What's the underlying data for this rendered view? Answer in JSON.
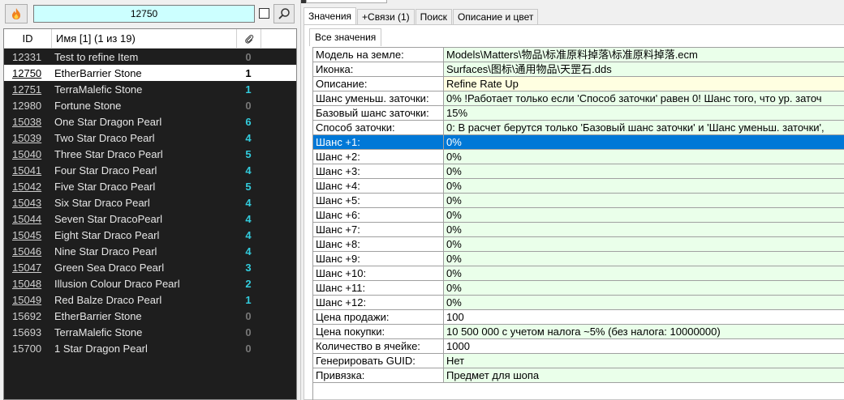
{
  "search": {
    "value": "12750"
  },
  "list": {
    "header": {
      "id": "ID",
      "name": "Имя [1] (1 из 19)"
    },
    "rows": [
      {
        "id": "12331",
        "name": "Test to refine Item",
        "count": "0",
        "color": "#777777",
        "underline": false,
        "selected": false
      },
      {
        "id": "12750",
        "name": "EtherBarrier Stone",
        "count": "1",
        "color": "#000000",
        "underline": true,
        "selected": true
      },
      {
        "id": "12751",
        "name": "TerraMalefic Stone",
        "count": "1",
        "color": "#33ccdd",
        "underline": true,
        "selected": false
      },
      {
        "id": "12980",
        "name": "Fortune Stone",
        "count": "0",
        "color": "#777777",
        "underline": false,
        "selected": false
      },
      {
        "id": "15038",
        "name": "One Star Dragon Pearl",
        "count": "6",
        "color": "#33ccdd",
        "underline": true,
        "selected": false
      },
      {
        "id": "15039",
        "name": "Two Star Draco Pearl",
        "count": "4",
        "color": "#33ccdd",
        "underline": true,
        "selected": false
      },
      {
        "id": "15040",
        "name": "Three Star Draco Pearl",
        "count": "5",
        "color": "#33ccdd",
        "underline": true,
        "selected": false
      },
      {
        "id": "15041",
        "name": "Four Star Draco Pearl",
        "count": "4",
        "color": "#33ccdd",
        "underline": true,
        "selected": false
      },
      {
        "id": "15042",
        "name": "Five Star Draco Pearl",
        "count": "5",
        "color": "#33ccdd",
        "underline": true,
        "selected": false
      },
      {
        "id": "15043",
        "name": "Six Star Draco Pearl",
        "count": "4",
        "color": "#33ccdd",
        "underline": true,
        "selected": false
      },
      {
        "id": "15044",
        "name": "Seven Star DracoPearl",
        "count": "4",
        "color": "#33ccdd",
        "underline": true,
        "selected": false
      },
      {
        "id": "15045",
        "name": "Eight Star Draco Pearl",
        "count": "4",
        "color": "#33ccdd",
        "underline": true,
        "selected": false
      },
      {
        "id": "15046",
        "name": "Nine Star Draco Pearl",
        "count": "4",
        "color": "#33ccdd",
        "underline": true,
        "selected": false
      },
      {
        "id": "15047",
        "name": "Green Sea Draco Pearl",
        "count": "3",
        "color": "#33ccdd",
        "underline": true,
        "selected": false
      },
      {
        "id": "15048",
        "name": "Illusion Colour Draco Pearl",
        "count": "2",
        "color": "#33ccdd",
        "underline": true,
        "selected": false
      },
      {
        "id": "15049",
        "name": "Red Balze Draco Pearl",
        "count": "1",
        "color": "#33ccdd",
        "underline": true,
        "selected": false
      },
      {
        "id": "15692",
        "name": "EtherBarrier Stone",
        "count": "0",
        "color": "#777777",
        "underline": false,
        "selected": false
      },
      {
        "id": "15693",
        "name": "TerraMalefic Stone",
        "count": "0",
        "color": "#777777",
        "underline": false,
        "selected": false
      },
      {
        "id": "15700",
        "name": "1 Star Dragon Pearl",
        "count": "0",
        "color": "#777777",
        "underline": false,
        "selected": false
      }
    ]
  },
  "tabs": [
    "Значения",
    "+Связи (1)",
    "Поиск",
    "Описание и цвет"
  ],
  "subtab": "Все значения",
  "properties": [
    {
      "key": "Модель на земле:",
      "value": "Models\\Matters\\物品\\标准原料掉落\\标准原料掉落.ecm",
      "bg": "green"
    },
    {
      "key": "Иконка:",
      "value": "Surfaces\\图标\\通用物品\\天罡石.dds",
      "bg": "green"
    },
    {
      "key": "Описание:",
      "value": "Refine Rate Up",
      "bg": "yellow"
    },
    {
      "key": "Шанс уменьш. заточки:",
      "value": "0% !Работает только если 'Способ заточки' равен 0! Шанс того, что ур. заточ",
      "bg": "green"
    },
    {
      "key": "Базовый шанс заточки:",
      "value": "15%",
      "bg": "green"
    },
    {
      "key": "Способ заточки:",
      "value": "0: В расчет берутся только 'Базовый шанс заточки' и 'Шанс уменьш. заточки',",
      "bg": "green"
    },
    {
      "key": "Шанс +1:",
      "value": "0%",
      "bg": "green",
      "selected": true
    },
    {
      "key": "Шанс +2:",
      "value": "0%",
      "bg": "green"
    },
    {
      "key": "Шанс +3:",
      "value": "0%",
      "bg": "green"
    },
    {
      "key": "Шанс +4:",
      "value": "0%",
      "bg": "green"
    },
    {
      "key": "Шанс +5:",
      "value": "0%",
      "bg": "green"
    },
    {
      "key": "Шанс +6:",
      "value": "0%",
      "bg": "green"
    },
    {
      "key": "Шанс +7:",
      "value": "0%",
      "bg": "green"
    },
    {
      "key": "Шанс +8:",
      "value": "0%",
      "bg": "green"
    },
    {
      "key": "Шанс +9:",
      "value": "0%",
      "bg": "green"
    },
    {
      "key": "Шанс +10:",
      "value": "0%",
      "bg": "green"
    },
    {
      "key": "Шанс +11:",
      "value": "0%",
      "bg": "green"
    },
    {
      "key": "Шанс +12:",
      "value": "0%",
      "bg": "green"
    },
    {
      "key": "Цена продажи:",
      "value": "100",
      "bg": "white"
    },
    {
      "key": "Цена покупки:",
      "value": "10 500 000 с учетом налога ~5% (без налога: 10000000)",
      "bg": "green"
    },
    {
      "key": "Количество в ячейке:",
      "value": "1000",
      "bg": "white"
    },
    {
      "key": "Генерировать GUID:",
      "value": "Нет",
      "bg": "green"
    },
    {
      "key": "Привязка:",
      "value": "Предмет для шопа",
      "bg": "green"
    }
  ],
  "icons": {
    "fire": "fire-icon",
    "search": "search-icon",
    "attach": "paperclip-icon"
  }
}
